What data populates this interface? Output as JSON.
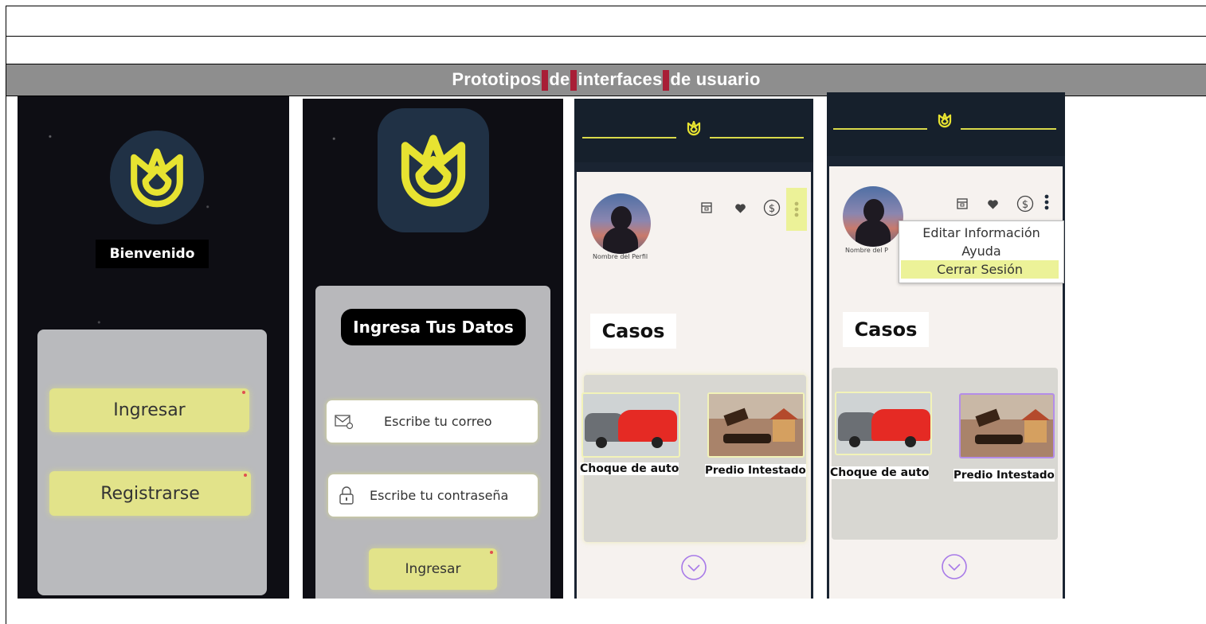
{
  "section_title": {
    "words": [
      "Prototipos",
      "de",
      "interfaces",
      "de usuario"
    ]
  },
  "screen1": {
    "welcome": "Bienvenido",
    "login_button": "Ingresar",
    "register_button": "Registrarse"
  },
  "screen2": {
    "heading": "Ingresa Tus Datos",
    "email_placeholder": "Escribe tu correo",
    "password_placeholder": "Escribe tu contraseña",
    "submit_button": "Ingresar"
  },
  "screen3": {
    "profile_name": "Nombre del Perfil",
    "cases_heading": "Casos",
    "cards": [
      {
        "label": "Choque de auto"
      },
      {
        "label": "Predio Intestado"
      }
    ]
  },
  "screen4": {
    "profile_name": "Nombre del P",
    "cases_heading": "Casos",
    "menu": [
      "Editar Información",
      "Ayuda",
      "Cerrar Sesión"
    ],
    "cards": [
      {
        "label": "Choque de auto"
      },
      {
        "label": "Predio Intestado"
      }
    ]
  },
  "colors": {
    "accent_yellow": "#e2e38a",
    "logo_yellow": "#e7e331",
    "logo_bg": "#203145",
    "header_gray": "#8e8e8e",
    "chevron_purple": "#a87ae8"
  },
  "icons": [
    "crown-logo-icon",
    "mail-icon",
    "lock-icon",
    "store-icon",
    "heart-icon",
    "dollar-circle-icon",
    "kebab-menu-icon",
    "chevron-down-circle-icon"
  ]
}
